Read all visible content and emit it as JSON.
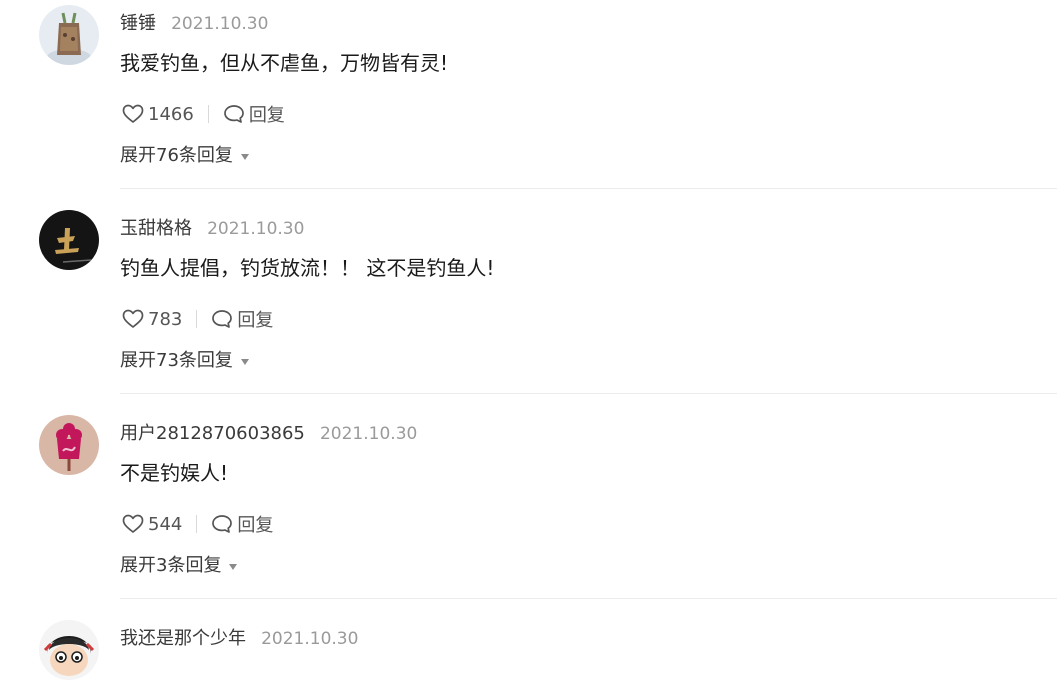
{
  "comments": [
    {
      "username": "锤锤",
      "date": "2021.10.30",
      "content": "我爱钓鱼，但从不虐鱼，万物皆有灵!",
      "likes": "1466",
      "reply_label": "回复",
      "expand_label": "展开76条回复"
    },
    {
      "username": "玉甜格格",
      "date": "2021.10.30",
      "content": "钓鱼人提倡，钓货放流！！ 这不是钓鱼人!",
      "likes": "783",
      "reply_label": "回复",
      "expand_label": "展开73条回复"
    },
    {
      "username": "用户2812870603865",
      "date": "2021.10.30",
      "content": "不是钓娱人!",
      "likes": "544",
      "reply_label": "回复",
      "expand_label": "展开3条回复"
    },
    {
      "username": "我还是那个少年",
      "date": "2021.10.30"
    }
  ],
  "colors": {
    "text_primary": "#1a1a1a",
    "text_secondary": "#3a3a3a",
    "date": "#9a9a9a",
    "divider": "#ececec"
  }
}
